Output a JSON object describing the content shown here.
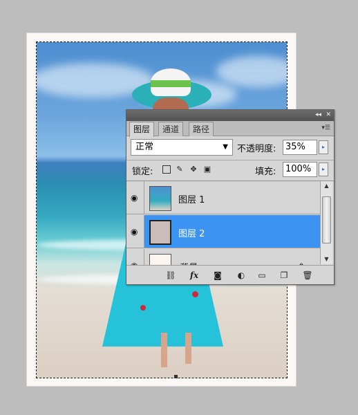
{
  "panel": {
    "tabs": [
      {
        "label": "图层"
      },
      {
        "label": "通道"
      },
      {
        "label": "路径"
      }
    ],
    "blend_mode": "正常",
    "opacity_label": "不透明度:",
    "opacity_value": "35%",
    "lock_label": "锁定:",
    "fill_label": "填充:",
    "fill_value": "100%",
    "layers": [
      {
        "name": "图层 1"
      },
      {
        "name": "图层 2"
      },
      {
        "name": "背景"
      }
    ]
  },
  "colors": {
    "selected_layer": "#3d93f2",
    "panel_bg": "#d6d6d6",
    "app_bg": "#bdbdbd"
  }
}
